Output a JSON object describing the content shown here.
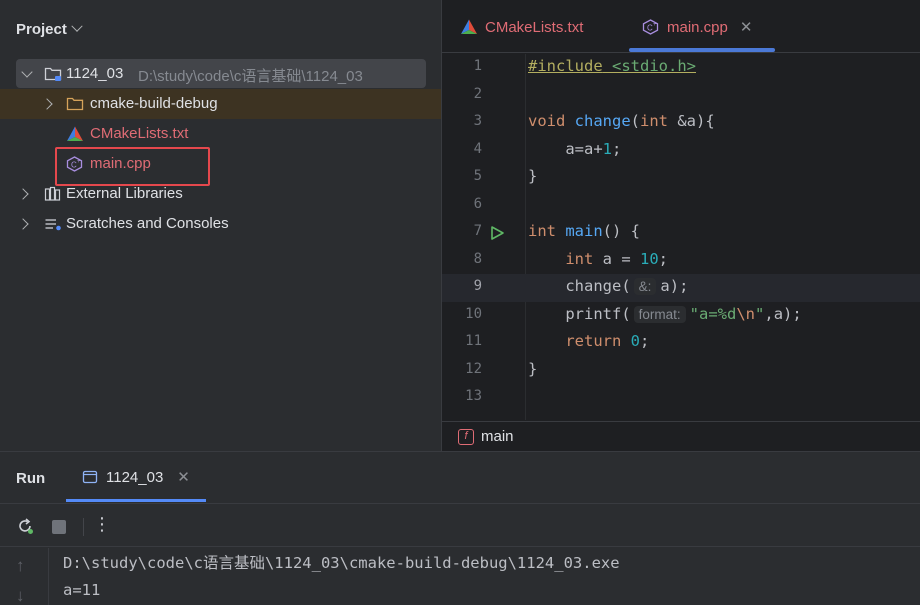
{
  "project_panel": {
    "title": "Project",
    "tree": {
      "root": {
        "name": "1124_03",
        "path": "D:\\study\\code\\c语言基础\\1124_03"
      },
      "cmake_build": "cmake-build-debug",
      "cmakelists": "CMakeLists.txt",
      "main_cpp": "main.cpp",
      "external_libraries": "External Libraries",
      "scratches": "Scratches and Consoles"
    }
  },
  "editor": {
    "tabs": [
      {
        "label": "CMakeLists.txt",
        "active": false
      },
      {
        "label": "main.cpp",
        "active": true
      }
    ],
    "line_numbers": [
      "1",
      "2",
      "3",
      "4",
      "5",
      "6",
      "7",
      "8",
      "9",
      "10",
      "11",
      "12",
      "13"
    ],
    "current_line": "9",
    "code": {
      "l1_include": "#include",
      "l1_header": "<stdio.h>",
      "l3_void": "void",
      "l3_fn": "change",
      "l3_paren": "(",
      "l3_int": "int",
      "l3_rest": " &a){",
      "l4_a": "    a=a+",
      "l4_num": "1",
      "l4_end": ";",
      "l5": "}",
      "l7_int": "int",
      "l7_main": "main",
      "l7_rest": "() {",
      "l8_indent": "    ",
      "l8_int": "int",
      "l8_mid": " a = ",
      "l8_num": "10",
      "l8_end": ";",
      "l9_call": "    change(",
      "l9_hint": "&:",
      "l9_rest": "a);",
      "l10_call": "    printf(",
      "l10_hint": "format:",
      "l10_str1": "\"a=%d",
      "l10_esc": "\\n",
      "l10_str2": "\"",
      "l10_rest": ",a);",
      "l11_indent": "    ",
      "l11_return": "return",
      "l11_sp": " ",
      "l11_num": "0",
      "l11_end": ";",
      "l12": "}"
    },
    "breadcrumb": "main"
  },
  "run_panel": {
    "title": "Run",
    "tab_label": "1124_03",
    "console_lines": [
      "D:\\study\\code\\c语言基础\\1124_03\\cmake-build-debug\\1124_03.exe",
      "a=11"
    ]
  },
  "colors": {
    "accent": "#548af7",
    "highlight_box": "#e5484d",
    "keyword": "#cf8e6d",
    "function": "#56a8f5",
    "number": "#2aacb8",
    "string": "#6aab73",
    "cmake_tab_text": "#e06c75"
  },
  "icons": [
    "folder-icon",
    "cmake-icon",
    "cpp-file-icon",
    "library-icon",
    "scratches-icon",
    "run-gutter-icon",
    "rerun-icon",
    "stop-icon",
    "more-icon",
    "scroll-up-icon",
    "scroll-down-icon",
    "console-tab-icon",
    "function-badge-icon"
  ]
}
